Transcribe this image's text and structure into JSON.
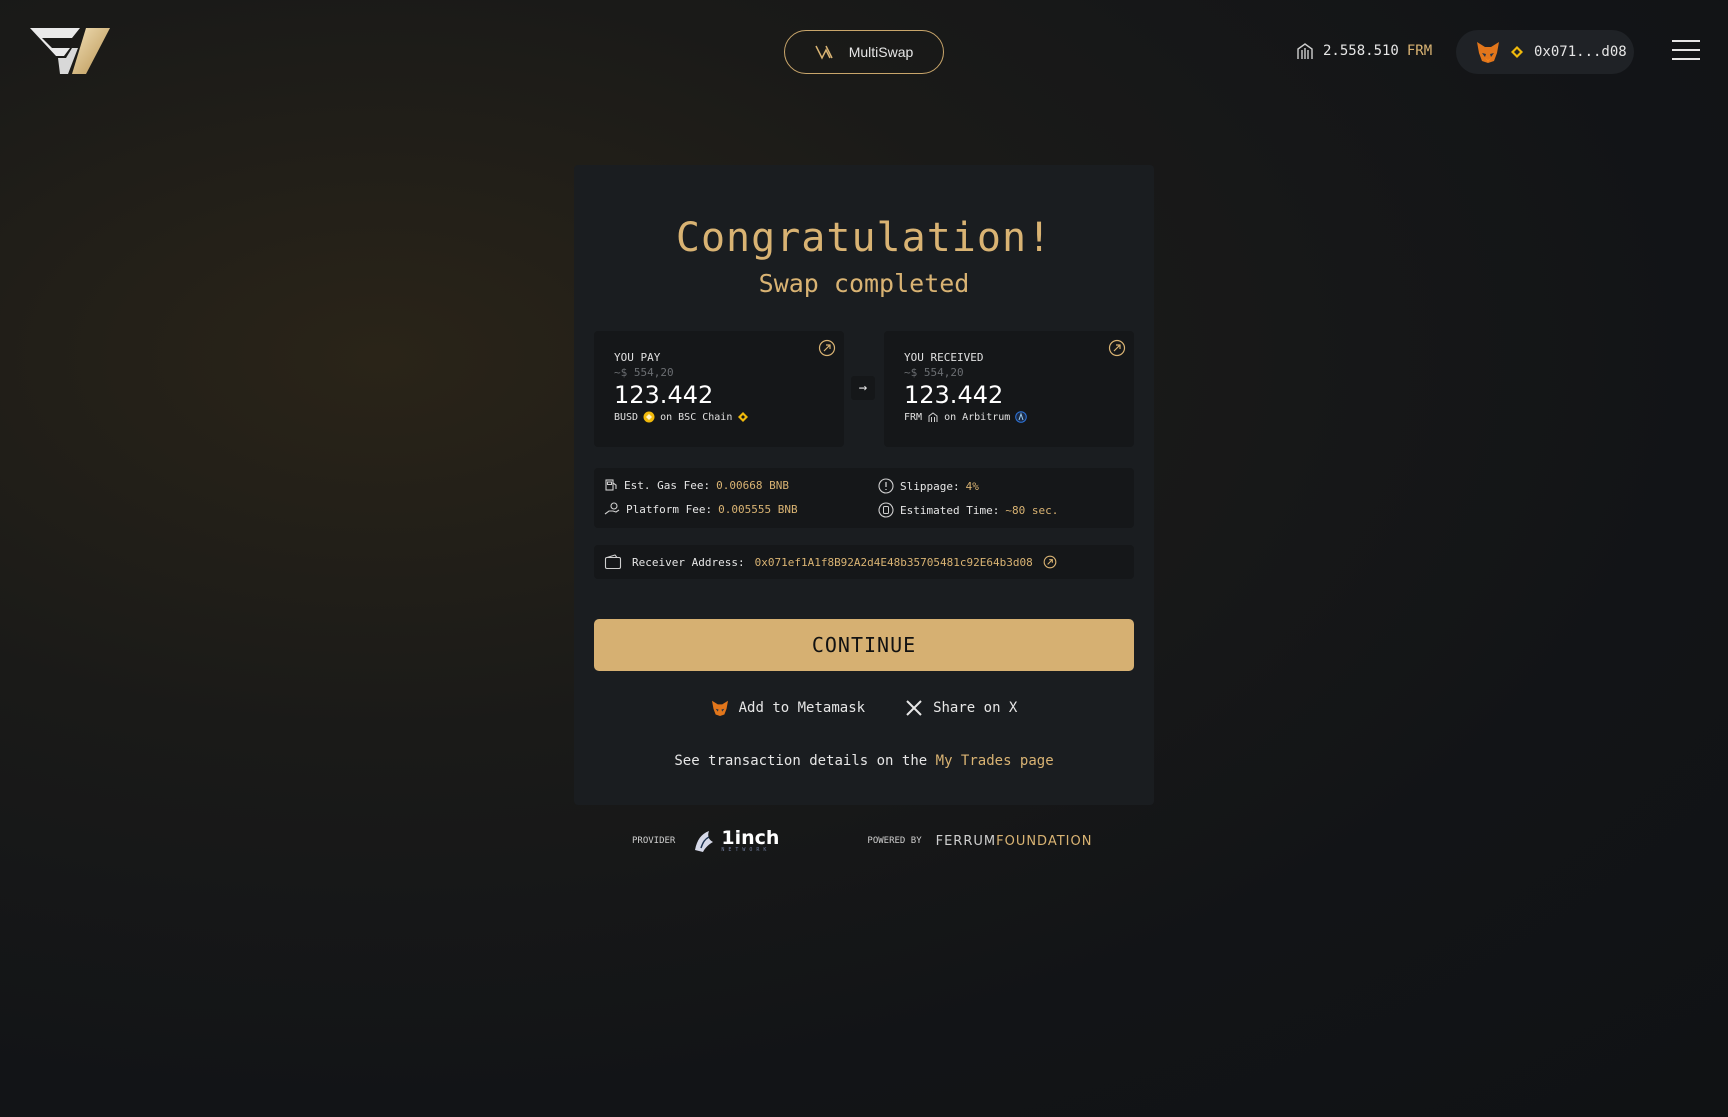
{
  "header": {
    "mode_label": "MultiSwap",
    "balance_value": "2.558.510",
    "balance_token": "FRM",
    "wallet_address": "0x071...d08"
  },
  "card": {
    "title": "Congratulation!",
    "subtitle": "Swap completed",
    "pay": {
      "label": "YOU PAY",
      "usd": "~$ 554,20",
      "amount": "123.442",
      "token": "BUSD",
      "chain": "on BSC Chain"
    },
    "receive": {
      "label": "YOU RECEIVED",
      "usd": "~$ 554,20",
      "amount": "123.442",
      "token": "FRM",
      "chain": "on Arbitrum"
    },
    "fees": {
      "gas_label": "Est. Gas Fee:",
      "gas_value": "0.00668 BNB",
      "platform_label": "Platform Fee:",
      "platform_value": "0.005555 BNB",
      "slippage_label": "Slippage:",
      "slippage_value": "4%",
      "time_label": "Estimated Time:",
      "time_value": "~80 sec."
    },
    "receiver": {
      "label": "Receiver Address:",
      "address": "0x071ef1A1f8B92A2d4E48b35705481c92E64b3d08"
    },
    "continue_label": "CONTINUE",
    "add_metamask_label": "Add to Metamask",
    "share_x_label": "Share on X",
    "tx_prefix": "See transaction details on the ",
    "tx_link": "My Trades page"
  },
  "footer": {
    "provider_label": "PROVIDER",
    "provider_name": "1inch",
    "provider_sub": "NETWORK",
    "powered_label": "POWERED BY",
    "powered_name_a": "FERRUM",
    "powered_name_b": "FOUNDATION"
  },
  "colors": {
    "accent": "#d9b373",
    "background": "#121417",
    "card": "#1a1d20",
    "panel": "#151719"
  }
}
